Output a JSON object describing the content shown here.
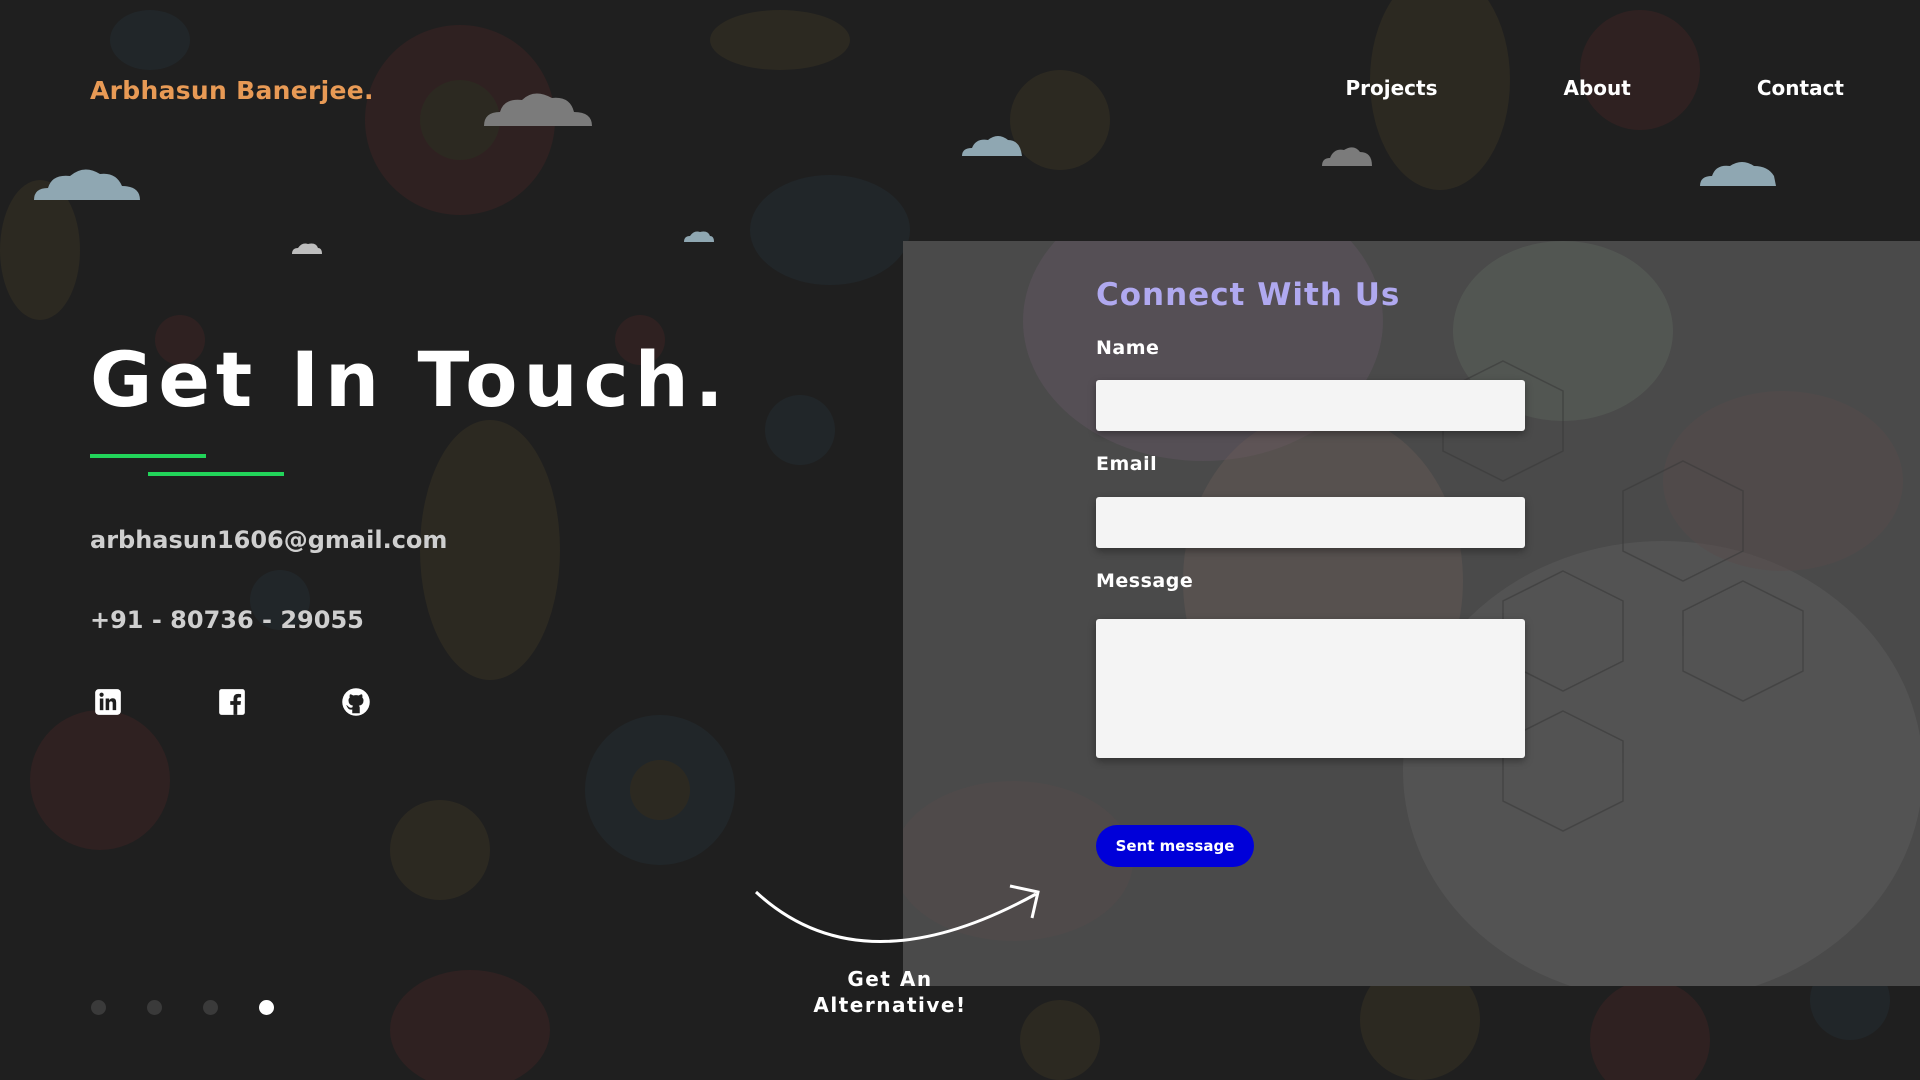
{
  "brand": {
    "name": "Arbhasun Banerjee."
  },
  "nav": {
    "items": [
      {
        "label": "Projects"
      },
      {
        "label": "About"
      },
      {
        "label": "Contact"
      }
    ]
  },
  "hero": {
    "title": "Get In Touch."
  },
  "contact": {
    "email": "arbhasun1606@gmail.com",
    "phone": "+91 - 80736 - 29055"
  },
  "socials": [
    {
      "icon": "linkedin-icon"
    },
    {
      "icon": "facebook-icon"
    },
    {
      "icon": "github-icon"
    }
  ],
  "pagination": {
    "count": 4,
    "active_index": 3
  },
  "alternative": {
    "line1": "Get An",
    "line2": "Alternative!"
  },
  "form": {
    "title": "Connect With Us",
    "name_label": "Name",
    "email_label": "Email",
    "message_label": "Message",
    "name_value": "",
    "email_value": "",
    "message_value": "",
    "submit_label": "Sent message"
  },
  "colors": {
    "brand": "#e89a55",
    "accent_underline": "#22d45a",
    "form_title": "#b0a9f0",
    "button": "#0000d9",
    "background": "#1f1f1f",
    "panel": "#4a4a4a"
  }
}
